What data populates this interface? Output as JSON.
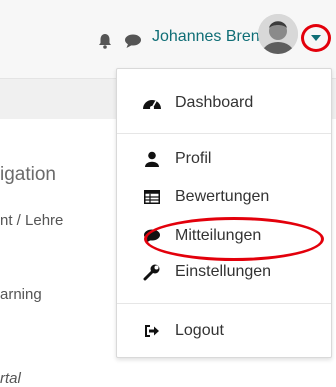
{
  "header": {
    "username": "Johannes Brenz",
    "icons": {
      "notification": "bell-icon",
      "messages": "chat-bubble-icon",
      "user_menu": "caret-down-icon"
    },
    "annotation_color": "#e3000b",
    "accent": "#0f6e76"
  },
  "nav": {
    "heading": "igation",
    "item1": "nt / Lehre",
    "item2": "arning",
    "item3": "rtal"
  },
  "user_menu": {
    "items": [
      {
        "label": "Dashboard",
        "icon": "dashboard-gauge-icon"
      },
      {
        "label": "Profil",
        "icon": "user-icon"
      },
      {
        "label": "Bewertungen",
        "icon": "table-icon"
      },
      {
        "label": "Mitteilungen",
        "icon": "chat-bubble-icon"
      },
      {
        "label": "Einstellungen",
        "icon": "wrench-icon"
      },
      {
        "label": "Logout",
        "icon": "sign-out-icon"
      }
    ]
  }
}
